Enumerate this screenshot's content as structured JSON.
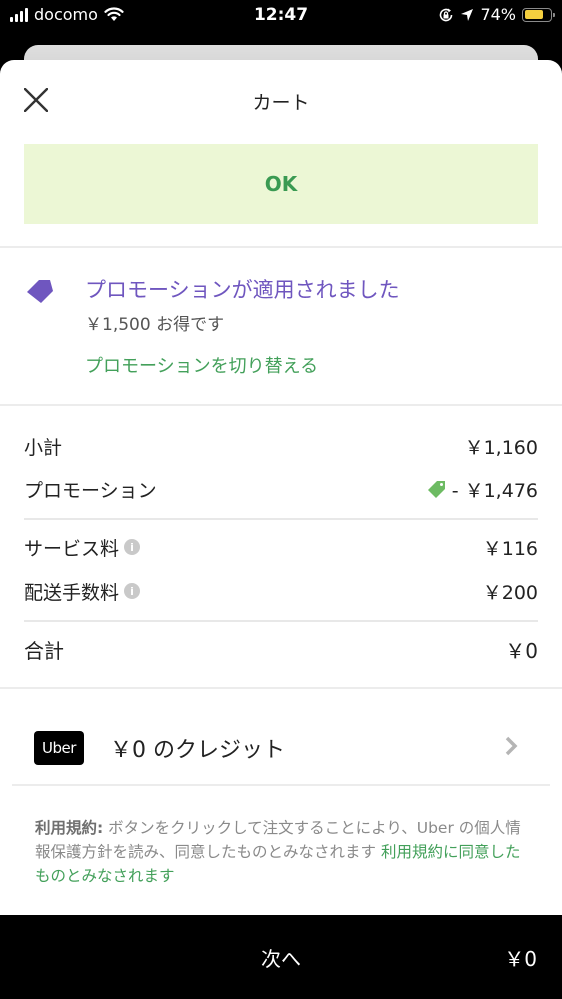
{
  "status_bar": {
    "carrier": "docomo",
    "time": "12:47",
    "battery_percent": "74%",
    "battery_level": 0.74,
    "icons": [
      "signal-icon",
      "wifi-icon",
      "orientation-lock-icon",
      "location-arrow-icon",
      "battery-icon"
    ]
  },
  "header": {
    "title": "カート",
    "close_icon": "close-icon"
  },
  "banner": {
    "label": "OK"
  },
  "promotion": {
    "title": "プロモーションが適用されました",
    "savings": "￥1,500 お得です",
    "switch_link": "プロモーションを切り替える",
    "icon": "tag-icon"
  },
  "fees": {
    "subtotal": {
      "label": "小計",
      "value": "￥1,160"
    },
    "promotion": {
      "label": "プロモーション",
      "value": "- ￥1,476"
    },
    "service_fee": {
      "label": "サービス料",
      "value": "￥116"
    },
    "delivery_fee": {
      "label": "配送手数料",
      "value": "￥200"
    },
    "total": {
      "label": "合計",
      "value": "￥0"
    }
  },
  "credit": {
    "logo_text": "Uber",
    "label": "￥0 のクレジット"
  },
  "terms": {
    "bold_prefix": "利用規約:",
    "body": " ボタンをクリックして注文することにより、Uber の個人情報保護方針を読み、同意したものとみなされます ",
    "link": "利用規約に同意したものとみなされます"
  },
  "footer": {
    "next_label": "次へ",
    "price": "￥0"
  },
  "colors": {
    "accent_green": "#43a05a",
    "promo_purple": "#6f56bf",
    "banner_bg": "#ecf7d5",
    "tag_green": "#6dbb63"
  }
}
